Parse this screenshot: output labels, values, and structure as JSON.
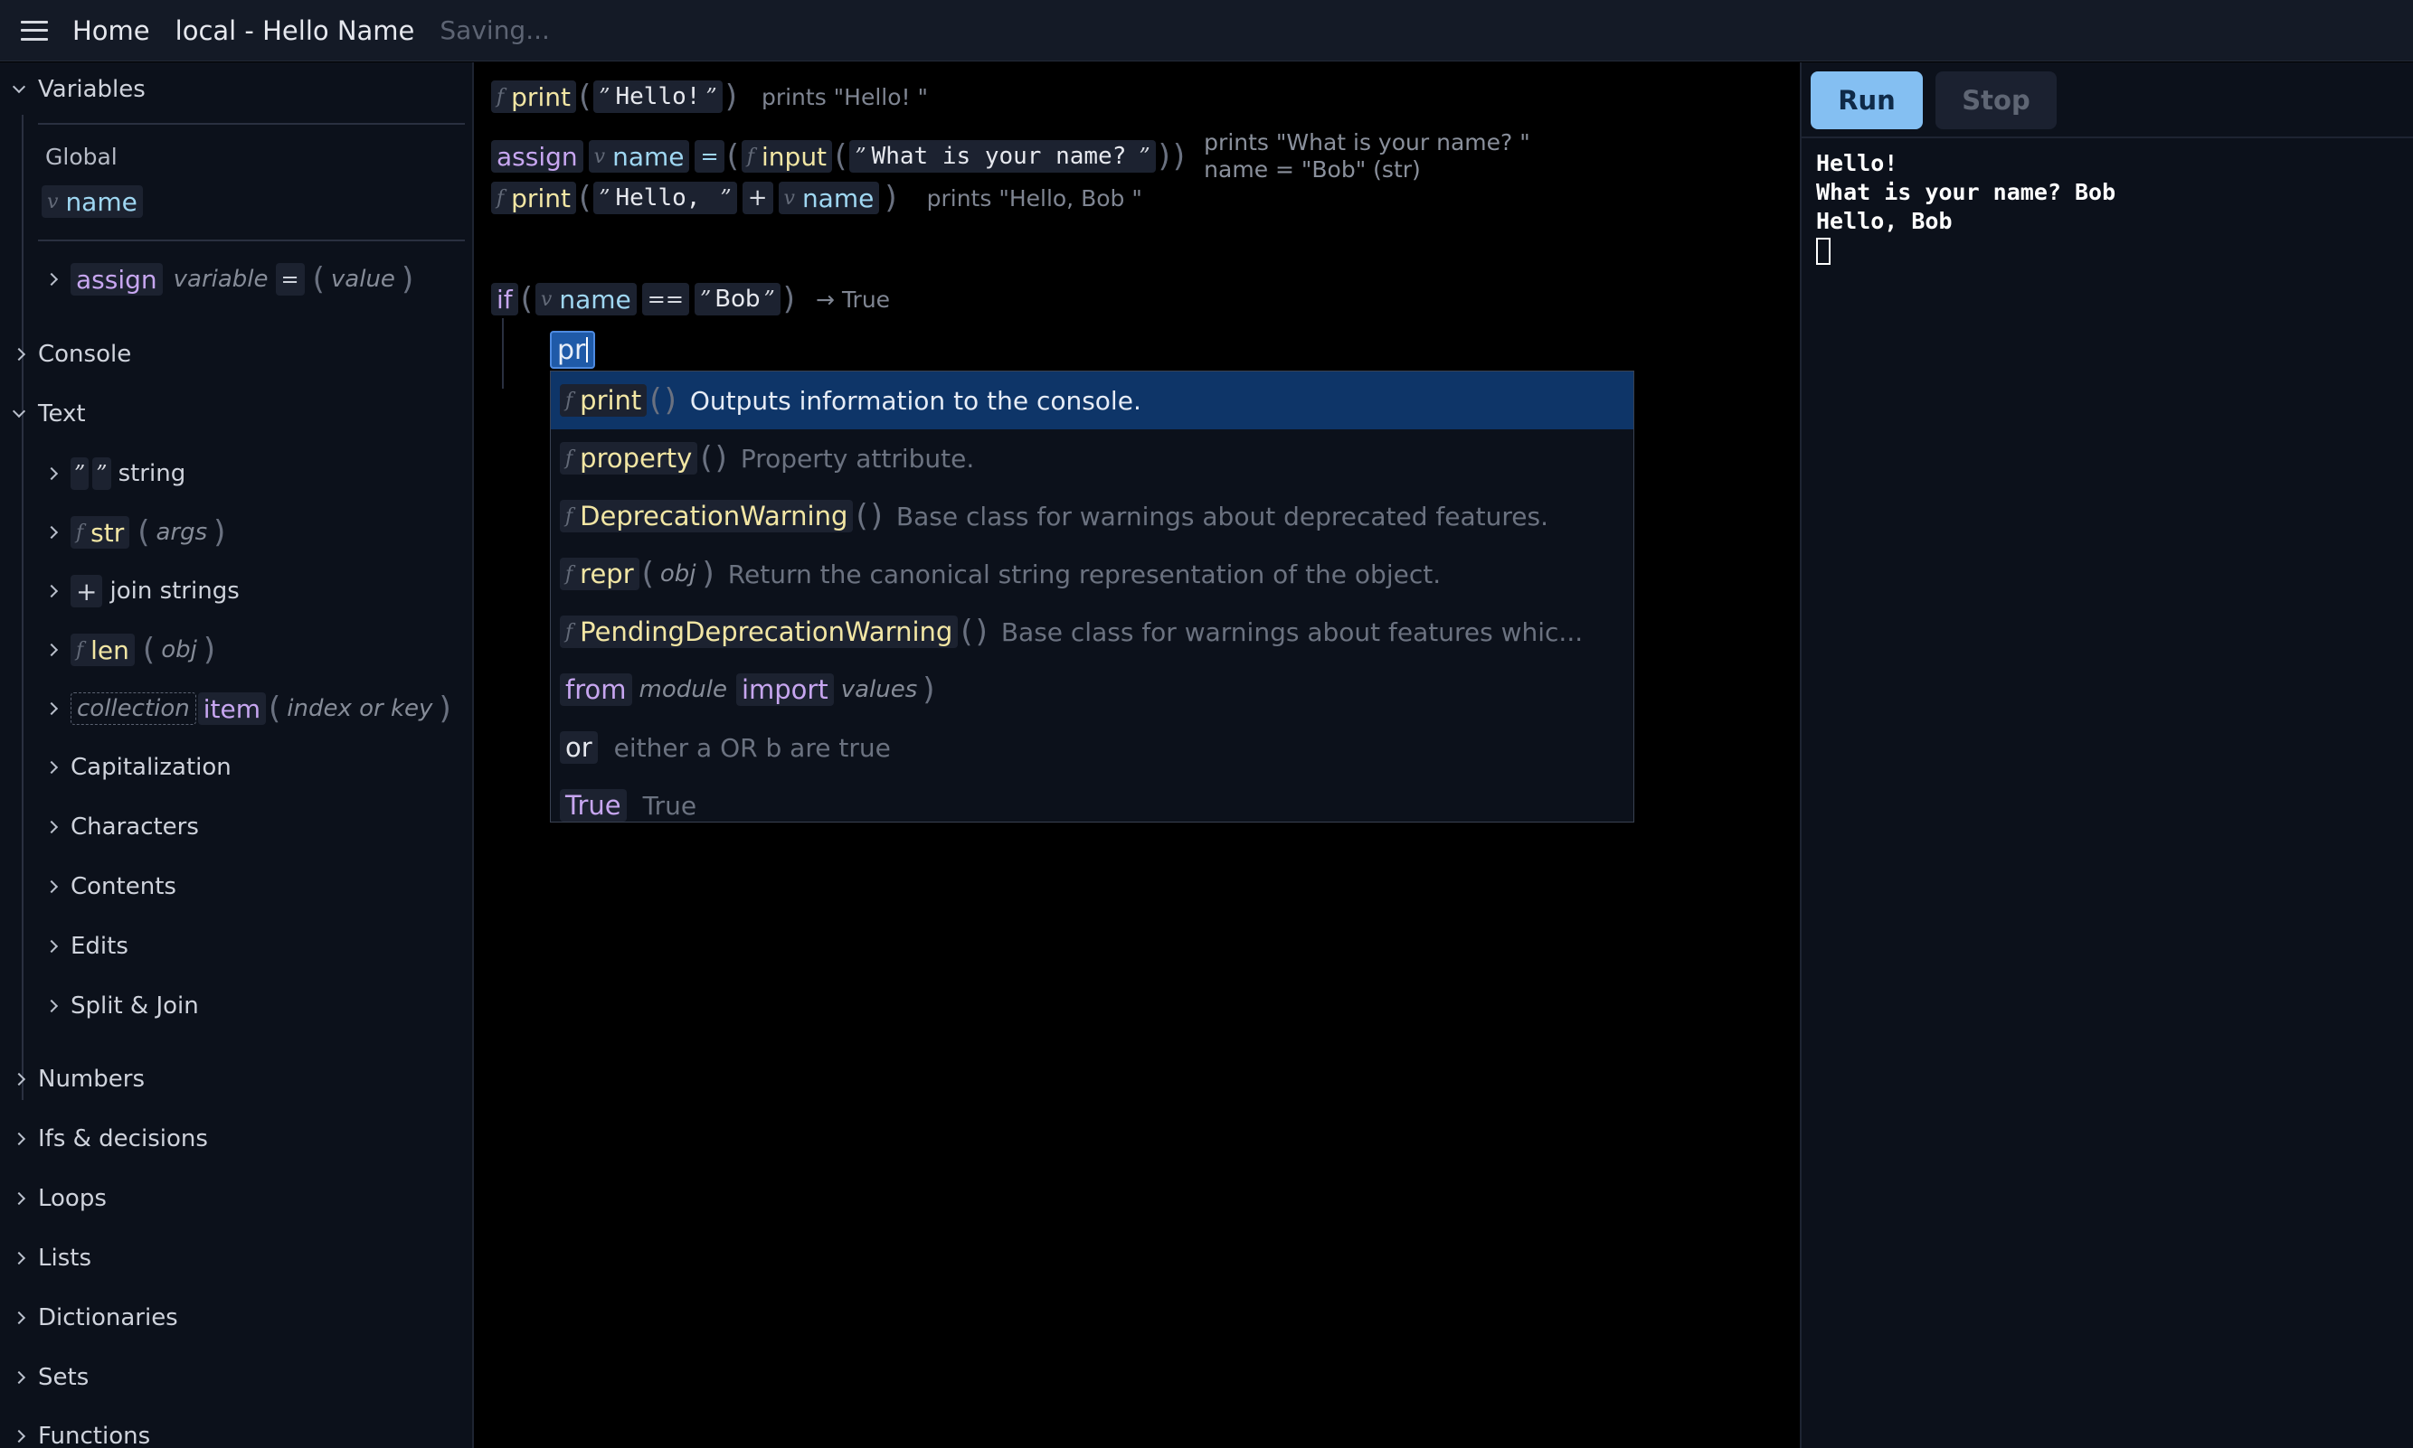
{
  "topbar": {
    "menu_icon": "hamburger-icon",
    "home_label": "Home",
    "project_title": "local - Hello Name",
    "status": "Saving..."
  },
  "sidebar": {
    "variables": {
      "label": "Variables",
      "global_label": "Global",
      "var_tag": "v",
      "var_name": "name",
      "assign_block": {
        "keyword": "assign",
        "variable": "variable",
        "eq": "=",
        "value": "value"
      }
    },
    "console_label": "Console",
    "text": {
      "label": "Text",
      "string_item": {
        "q1": "”",
        "q2": "”",
        "label": "string"
      },
      "str_item": {
        "tag": "f",
        "name": "str",
        "arg": "args"
      },
      "join_item": {
        "op": "+",
        "label": "join strings"
      },
      "len_item": {
        "tag": "f",
        "name": "len",
        "arg": "obj"
      },
      "item_item": {
        "collection": "collection",
        "name": "item",
        "arg": "index or key"
      },
      "subcategories": [
        "Capitalization",
        "Characters",
        "Contents",
        "Edits",
        "Split & Join"
      ]
    },
    "categories": [
      "Numbers",
      "Ifs & decisions",
      "Loops",
      "Lists",
      "Dictionaries",
      "Sets",
      "Functions"
    ]
  },
  "editor": {
    "line1": {
      "tag": "f",
      "fn": "print",
      "q": "”",
      "str": "Hello!",
      "result": "prints \"Hello! \""
    },
    "line2": {
      "assign": "assign",
      "vtag": "v",
      "var": "name",
      "eq": "=",
      "tag": "f",
      "fn": "input",
      "q": "”",
      "str": "What is your name?",
      "result1": "prints \"What is your name? \"",
      "result2": "name = \"Bob\" (str)"
    },
    "line3": {
      "tag": "f",
      "fn": "print",
      "q": "”",
      "str": "Hello,",
      "plus": "+",
      "vtag": "v",
      "var": "name",
      "result": "prints \"Hello, Bob \""
    },
    "if_line": {
      "kw": "if",
      "vtag": "v",
      "var": "name",
      "op": "==",
      "q": "”",
      "str": "Bob",
      "result": "→ True"
    },
    "typing": "pr"
  },
  "autocomplete": {
    "items": [
      {
        "tag": "f",
        "name": "print",
        "arg": "",
        "desc": "Outputs information to the console."
      },
      {
        "tag": "f",
        "name": "property",
        "arg": "",
        "desc": "Property attribute."
      },
      {
        "tag": "f",
        "name": "DeprecationWarning",
        "arg": "",
        "desc": "Base class for warnings about deprecated features."
      },
      {
        "tag": "f",
        "name": "repr",
        "arg": "obj",
        "desc": "Return the canonical string representation of the object."
      },
      {
        "tag": "f",
        "name": "PendingDeprecationWarning",
        "arg": "",
        "desc": "Base class for warnings about features whic..."
      }
    ],
    "from_import": {
      "from": "from",
      "module": "module",
      "import": "import",
      "values": "values"
    },
    "or_item": {
      "kw": "or",
      "desc": "either a OR b are true"
    },
    "true_item": {
      "kw": "True",
      "desc": "True"
    }
  },
  "run_panel": {
    "run_label": "Run",
    "stop_label": "Stop",
    "console_lines": [
      "Hello!",
      "What is your name? Bob",
      "Hello, Bob"
    ]
  },
  "colors": {
    "topbar_bg": "#141a26",
    "sidebar_bg": "#0c111b",
    "run_button": "#84bff2",
    "selection": "#0e3568",
    "function_name": "#f2e6a4",
    "keyword": "#c7a6f0",
    "variable": "#9fd7f2"
  }
}
